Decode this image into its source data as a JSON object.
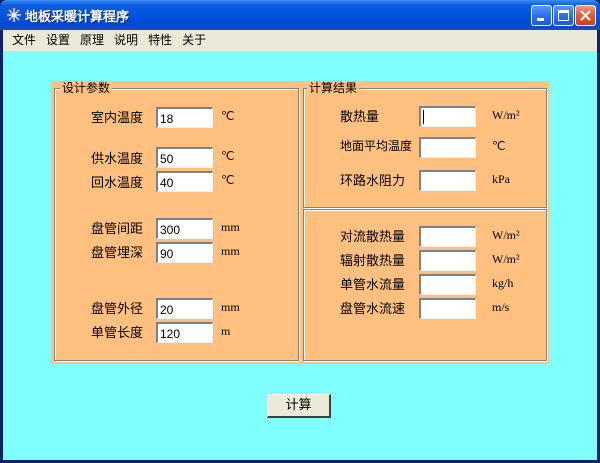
{
  "window": {
    "title": "地板采暖计算程序"
  },
  "menu": [
    "文件",
    "设置",
    "原理",
    "说明",
    "特性",
    "关于"
  ],
  "design_params": {
    "title": "设计参数",
    "indoor_temp": {
      "label": "室内温度",
      "value": "18",
      "unit": "℃"
    },
    "supply_temp": {
      "label": "供水温度",
      "value": "50",
      "unit": "℃"
    },
    "return_temp": {
      "label": "回水温度",
      "value": "40",
      "unit": "℃"
    },
    "pipe_spacing": {
      "label": "盘管间距",
      "value": "300",
      "unit": "mm"
    },
    "pipe_depth": {
      "label": "盘管埋深",
      "value": "90",
      "unit": "mm"
    },
    "pipe_diameter": {
      "label": "盘管外径",
      "value": "20",
      "unit": "mm"
    },
    "pipe_length": {
      "label": "单管长度",
      "value": "120",
      "unit": "m"
    }
  },
  "results": {
    "title": "计算结果",
    "heat_dissipation": {
      "label": "散热量",
      "value": "",
      "unit": "W/m²"
    },
    "avg_floor_temp": {
      "label": "地面平均温度",
      "value": "",
      "unit": "℃"
    },
    "loop_resistance": {
      "label": "环路水阻力",
      "value": "",
      "unit": "kPa"
    },
    "convective_heat": {
      "label": "对流散热量",
      "value": "",
      "unit": "W/m²"
    },
    "radiant_heat": {
      "label": "辐射散热量",
      "value": "",
      "unit": "W/m²"
    },
    "single_pipe_flow": {
      "label": "单管水流量",
      "value": "",
      "unit": "kg/h"
    },
    "pipe_water_velocity": {
      "label": "盘管水流速",
      "value": "",
      "unit": "m/s"
    }
  },
  "calculate_button": {
    "label": "计算"
  },
  "colors": {
    "client_bg": "#80ffff",
    "panel_bg": "#ffc080",
    "titlebar": "#0054e3",
    "menubar": "#ece9d8"
  }
}
